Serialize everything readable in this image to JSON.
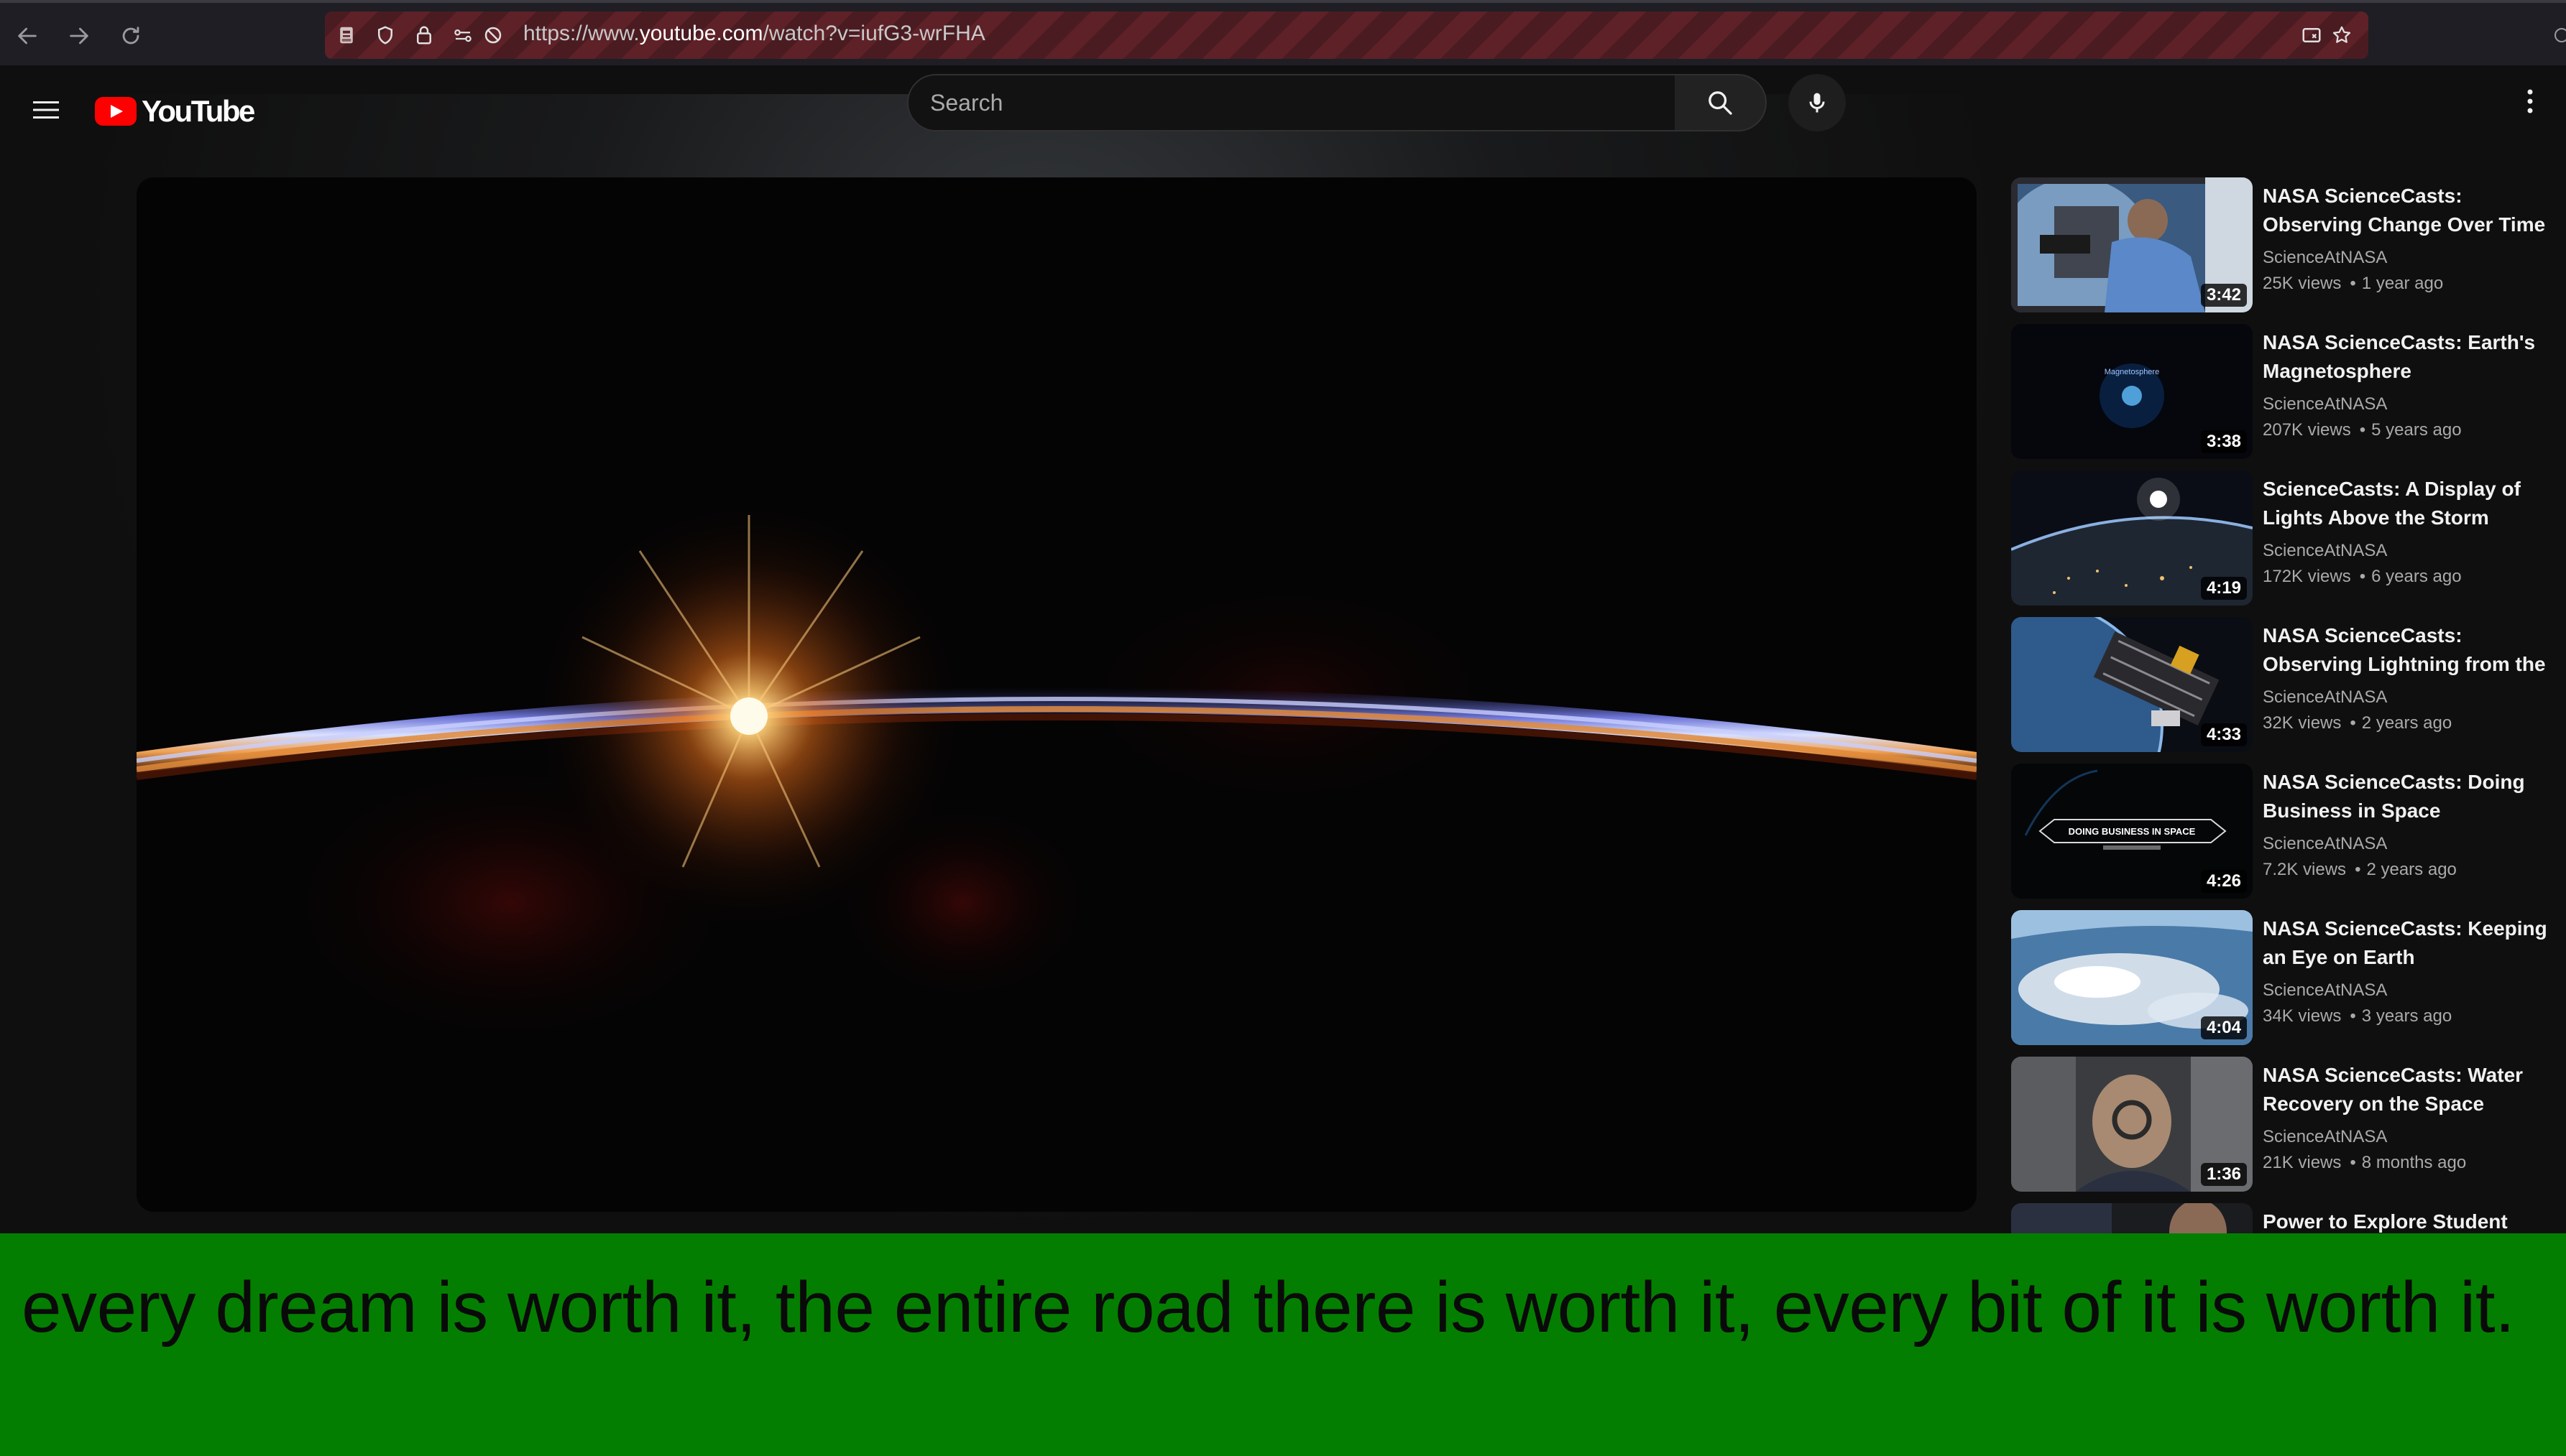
{
  "browser": {
    "url_prefix": "https://www.",
    "url_host": "youtube.com",
    "url_path": "/watch?v=iufG3-wrFHA"
  },
  "youtube": {
    "logo_text": "YouTube",
    "search_placeholder": "Search"
  },
  "recommendations": [
    {
      "title": "NASA ScienceCasts: Observing Change Over Time",
      "channel": "ScienceAtNASA",
      "views": "25K views",
      "age": "1 year ago",
      "duration": "3:42",
      "thumb_theme": "astronaut-window"
    },
    {
      "title": "NASA ScienceCasts: Earth's Magnetosphere",
      "channel": "ScienceAtNASA",
      "views": "207K views",
      "age": "5 years ago",
      "duration": "3:38",
      "thumb_theme": "magnetosphere",
      "thumb_label": "Magnetosphere"
    },
    {
      "title": "ScienceCasts: A Display of Lights Above the Storm",
      "channel": "ScienceAtNASA",
      "views": "172K views",
      "age": "6 years ago",
      "duration": "4:19",
      "thumb_theme": "earth-lights"
    },
    {
      "title": "NASA ScienceCasts: Observing Lightning from the International Space Station",
      "channel": "ScienceAtNASA",
      "views": "32K views",
      "age": "2 years ago",
      "duration": "4:33",
      "thumb_theme": "space-station"
    },
    {
      "title": "NASA ScienceCasts: Doing Business in Space",
      "channel": "ScienceAtNASA",
      "views": "7.2K views",
      "age": "2 years ago",
      "duration": "4:26",
      "thumb_theme": "business-in-space",
      "thumb_label": "DOING BUSINESS IN SPACE"
    },
    {
      "title": "NASA ScienceCasts: Keeping an Eye on Earth",
      "channel": "ScienceAtNASA",
      "views": "34K views",
      "age": "3 years ago",
      "duration": "4:04",
      "thumb_theme": "earth-clouds"
    },
    {
      "title": "NASA ScienceCasts: Water Recovery on the Space Station",
      "channel": "ScienceAtNASA",
      "views": "21K views",
      "age": "8 months ago",
      "duration": "1:36",
      "thumb_theme": "astronaut-water"
    },
    {
      "title": "Power to Explore Student",
      "channel": "",
      "views": "",
      "age": "",
      "duration": "",
      "thumb_theme": "partial"
    }
  ],
  "caption": {
    "text": "every dream is worth it, the entire road there is worth it, every bit of it is worth it."
  },
  "colors": {
    "caption_background": "#047e00",
    "youtube_red": "#ff0000",
    "page_background": "#0f0f0f",
    "url_bar_stripe": "#5e2128"
  },
  "icons": [
    "back-arrow-icon",
    "forward-arrow-icon",
    "reload-icon",
    "identity-icon",
    "shield-icon",
    "lock-icon",
    "permissions-icon",
    "no-tracking-icon",
    "reader-mode-icon",
    "bookmark-star-icon",
    "hamburger-menu-icon",
    "youtube-logo-icon",
    "search-icon",
    "microphone-icon",
    "more-vert-icon"
  ]
}
